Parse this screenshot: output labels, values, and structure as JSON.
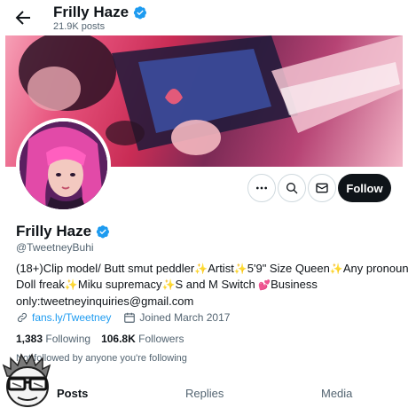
{
  "header": {
    "display_name": "Frilly Haze",
    "posts_count": "21.9K posts"
  },
  "profile": {
    "display_name": "Frilly Haze",
    "handle": "@TweetneyBuhi",
    "bio": {
      "line1_a": "(18+)Clip model/ Butt smut peddler",
      "line1_b": "Artist",
      "line1_c": "5'9\" Size Queen",
      "line1_d": "Any pronoun",
      "line2_a": "Doll freak",
      "line2_b": "Miku supremacy",
      "line2_c": "S and M Switch",
      "line2_d": "Business",
      "line3": "only:tweetneyinquiries@gmail.com"
    },
    "link": "fans.ly/Tweetney",
    "joined": "Joined March 2017",
    "following_count": "1,383",
    "following_label": "Following",
    "followers_count": "106.8K",
    "followers_label": "Followers",
    "followed_by": "Not followed by anyone you're following"
  },
  "actions": {
    "follow_label": "Follow"
  },
  "tabs": [
    {
      "label": "Posts"
    },
    {
      "label": "Replies"
    },
    {
      "label": "Media"
    }
  ],
  "icons": {
    "verified": "verified-badge-icon",
    "sparkle": "sparkle-emoji",
    "hearts": "two-hearts-emoji"
  },
  "colors": {
    "accent": "#1d9bf0",
    "follow_button_bg": "#0f1419",
    "text_primary": "#0f1419",
    "text_secondary": "#536471"
  }
}
